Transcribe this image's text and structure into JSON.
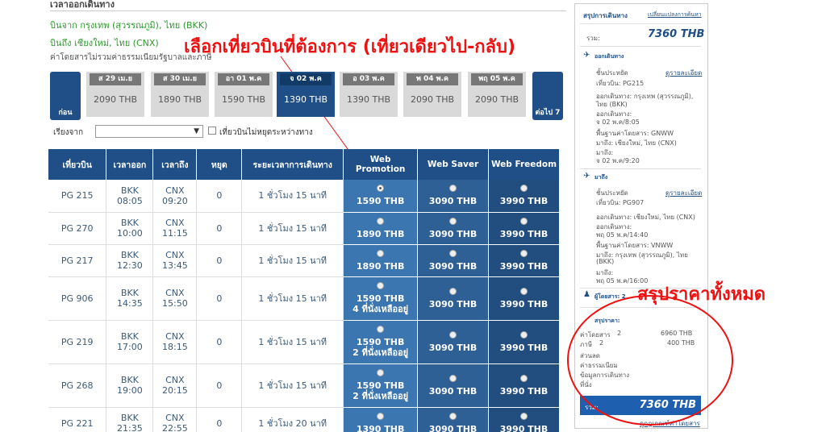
{
  "header": {
    "title": "เวลาออกเดินทาง",
    "from": "บินจาก กรุงเทพ (สุวรรณภูมิ), ไทย (BKK)",
    "to": "บินถึง เชียงใหม่, ไทย (CNX)",
    "note": "ค่าโดยสารไม่รวมค่าธรรมเนียมรัฐบาลและภาษี"
  },
  "annotations": {
    "select_flight": "เลือกเที่ยวบินที่ต้องการ (เที่ยวเดียวไป-กลับ)",
    "summary_all": "สรุปราคาทั้งหมด"
  },
  "date_nav": {
    "prev_label": "ก่อน",
    "next_label": "ต่อไป 7",
    "dates": [
      {
        "label": "ส 29 เม.ย",
        "price": "2090 THB"
      },
      {
        "label": "ส 30 เม.ย",
        "price": "1890 THB"
      },
      {
        "label": "อา 01 พ.ค",
        "price": "1590 THB"
      },
      {
        "label": "จ 02 พ.ค",
        "price": "1390 THB"
      },
      {
        "label": "อ 03 พ.ค",
        "price": "1390 THB"
      },
      {
        "label": "พ 04 พ.ค",
        "price": "2090 THB"
      },
      {
        "label": "พฤ 05 พ.ค",
        "price": "2090 THB"
      }
    ],
    "selected_index": 3
  },
  "filter": {
    "label": "เรียงจาก",
    "select_value": "▼",
    "nonstop_label": "เที่ยวบินไม่หยุดระหว่างทาง"
  },
  "table": {
    "headers": [
      "เที่ยวบิน",
      "เวลาออก",
      "เวลาถึง",
      "หยุด",
      "ระยะเวลาการเดินทาง",
      "Web Promotion",
      "Web Saver",
      "Web Freedom"
    ],
    "rows": [
      {
        "flight": "PG 215",
        "dep": "BKK 08:05",
        "arr": "CNX 09:20",
        "stops": "0",
        "duration": "1 ชั่วโมง 15 นาที",
        "promo": "1590 THB",
        "promo_note": "",
        "saver": "3090 THB",
        "freedom": "3990 THB"
      },
      {
        "flight": "PG 270",
        "dep": "BKK 10:00",
        "arr": "CNX 11:15",
        "stops": "0",
        "duration": "1 ชั่วโมง 15 นาที",
        "promo": "1890 THB",
        "promo_note": "",
        "saver": "3090 THB",
        "freedom": "3990 THB"
      },
      {
        "flight": "PG 217",
        "dep": "BKK 12:30",
        "arr": "CNX 13:45",
        "stops": "0",
        "duration": "1 ชั่วโมง 15 นาที",
        "promo": "1890 THB",
        "promo_note": "",
        "saver": "3090 THB",
        "freedom": "3990 THB"
      },
      {
        "flight": "PG 906",
        "dep": "BKK 14:35",
        "arr": "CNX 15:50",
        "stops": "0",
        "duration": "1 ชั่วโมง 15 นาที",
        "promo": "1590 THB",
        "promo_note": "4 ที่นั่งเหลืออยู่",
        "saver": "3090 THB",
        "freedom": "3990 THB"
      },
      {
        "flight": "PG 219",
        "dep": "BKK 17:00",
        "arr": "CNX 18:15",
        "stops": "0",
        "duration": "1 ชั่วโมง 15 นาที",
        "promo": "1590 THB",
        "promo_note": "2 ที่นั่งเหลืออยู่",
        "saver": "3090 THB",
        "freedom": "3990 THB"
      },
      {
        "flight": "PG 268",
        "dep": "BKK 19:00",
        "arr": "CNX 20:15",
        "stops": "0",
        "duration": "1 ชั่วโมง 15 นาที",
        "promo": "1590 THB",
        "promo_note": "2 ที่นั่งเหลืออยู่",
        "saver": "3090 THB",
        "freedom": "3990 THB"
      },
      {
        "flight": "PG 221",
        "dep": "BKK 21:35",
        "arr": "CNX 22:55",
        "stops": "0",
        "duration": "1 ชั่วโมง 20 นาที",
        "promo": "1390 THB",
        "promo_note": "",
        "saver": "3090 THB",
        "freedom": "3990 THB"
      }
    ]
  },
  "sidebar": {
    "title": "สรุปการเดินทาง",
    "change_link": "เปลี่ยนแปลงการค้นหา",
    "total_label": "รวม:",
    "total": "7360 THB",
    "depart_label": "ออกเดินทาง",
    "depart": {
      "class": "ชั้นประหยัด",
      "details_link": "ดูรายละเอียด",
      "flight": "เที่ยวบิน: PG215",
      "from_line1": "ออกเดินทาง: กรุงเทพ (สุวรรณภูมิ),",
      "from_line2": "ไทย (BKK)",
      "dep_label": "ออกเดินทาง:",
      "dep_time": "จ 02 พ.ค/8:05",
      "fare_basis": "พื้นฐานค่าโดยสาร: GNWW",
      "to": "มาถึง: เชียงใหม่, ไทย (CNX)",
      "arr_label": "มาถึง:",
      "arr_time": "จ 02 พ.ค/9:20"
    },
    "return_label": "มาถึง",
    "return": {
      "class": "ชั้นประหยัด",
      "details_link": "ดูรายละเอียด",
      "flight": "เที่ยวบิน: PG907",
      "from_line1": "ออกเดินทาง: เชียงใหม่, ไทย (CNX)",
      "dep_label": "ออกเดินทาง:",
      "dep_time": "พฤ 05 พ.ค/14:40",
      "fare_basis": "พื้นฐานค่าโดยสาร: VNWW",
      "to_line1": "มาถึง: กรุงเทพ (สุวรรณภูมิ), ไทย",
      "to_line2": "(BKK)",
      "arr_label": "มาถึง:",
      "arr_time": "พฤ 05 พ.ค/16:00"
    },
    "passengers": "ผู้โดยสาร: 2",
    "price_title": "สรุปราคา:",
    "fare_label": "ค่าโดยสาร",
    "fare_count": "2",
    "fare_value": "6960 THB",
    "tax_label": "ภาษี",
    "tax_count": "2",
    "tax_value": "400 THB",
    "discount_label": "ส่วนลด",
    "fee_label": "ค่าธรรมเนียม",
    "travel_info_label": "ข้อมูลการเดินทาง",
    "seat_label": "ที่นั่ง",
    "bottom_total_label": "รวม:",
    "bottom_total": "7360 THB",
    "rules_link": "ดูกฎเกณฑ์ค่าโดยสาร"
  },
  "colors": {
    "brand_dark": "#1f4f86",
    "web_promotion": "#3b76b1",
    "web_saver": "#2e5f95",
    "web_freedom": "#214d7f",
    "annotation": "#ee1111"
  }
}
